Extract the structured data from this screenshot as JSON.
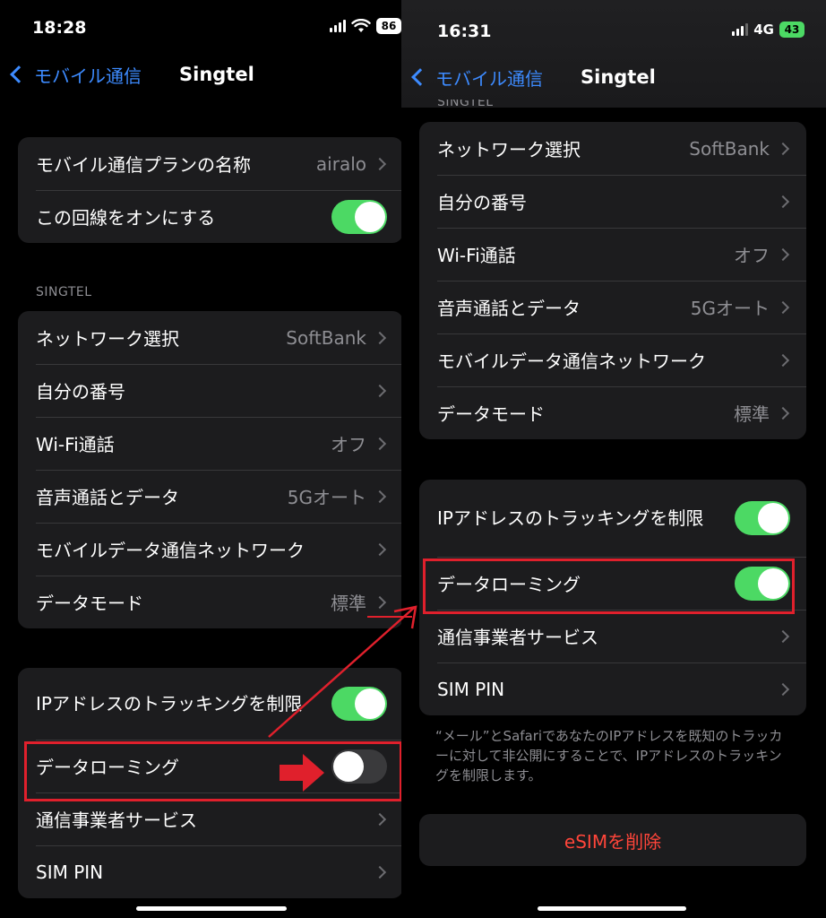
{
  "left": {
    "status": {
      "time": "18:28",
      "battery": "86"
    },
    "nav": {
      "back_label": "モバイル通信",
      "title": "Singtel"
    },
    "plan_group": {
      "plan_name_label": "モバイル通信プランの名称",
      "plan_name_value": "airalo",
      "line_on_label": "この回線をオンにする",
      "line_on_state": true
    },
    "section_header": "SINGTEL",
    "network_group": [
      {
        "label": "ネットワーク選択",
        "value": "SoftBank"
      },
      {
        "label": "自分の番号",
        "value": ""
      },
      {
        "label": "Wi-Fi通話",
        "value": "オフ"
      },
      {
        "label": "音声通話とデータ",
        "value": "5Gオート"
      },
      {
        "label": "モバイルデータ通信ネットワーク",
        "value": ""
      },
      {
        "label": "データモード",
        "value": "標準"
      }
    ],
    "bottom_group": {
      "ip_tracking_label": "IPアドレスのトラッキングを制限",
      "ip_tracking_state": true,
      "data_roaming_label": "データローミング",
      "data_roaming_state": false,
      "carrier_services_label": "通信事業者サービス",
      "sim_pin_label": "SIM PIN"
    }
  },
  "right": {
    "status": {
      "time": "16:31",
      "network": "4G",
      "battery": "43"
    },
    "nav": {
      "back_label": "モバイル通信",
      "title": "Singtel"
    },
    "section_header": "SINGTEL",
    "network_group": [
      {
        "label": "ネットワーク選択",
        "value": "SoftBank"
      },
      {
        "label": "自分の番号",
        "value": ""
      },
      {
        "label": "Wi-Fi通話",
        "value": "オフ"
      },
      {
        "label": "音声通話とデータ",
        "value": "5Gオート"
      },
      {
        "label": "モバイルデータ通信ネットワーク",
        "value": ""
      },
      {
        "label": "データモード",
        "value": "標準"
      }
    ],
    "bottom_group": {
      "ip_tracking_label": "IPアドレスのトラッキングを制限",
      "ip_tracking_state": true,
      "data_roaming_label": "データローミング",
      "data_roaming_state": true,
      "carrier_services_label": "通信事業者サービス",
      "sim_pin_label": "SIM PIN"
    },
    "footer_note": "“メール”とSafariであなたのIPアドレスを既知のトラッカーに対して非公開にすることで、IPアドレスのトラッキングを制限します。",
    "delete_esim_label": "eSIMを削除"
  },
  "colors": {
    "accent": "#3d8bff",
    "toggle_on": "#4cd964",
    "highlight": "#e0202c",
    "danger": "#ff453a"
  },
  "icons": [
    "back-chevron-icon",
    "signal-bars-icon",
    "wifi-icon",
    "battery-icon",
    "chevron-right-icon",
    "red-arrow-icon"
  ]
}
